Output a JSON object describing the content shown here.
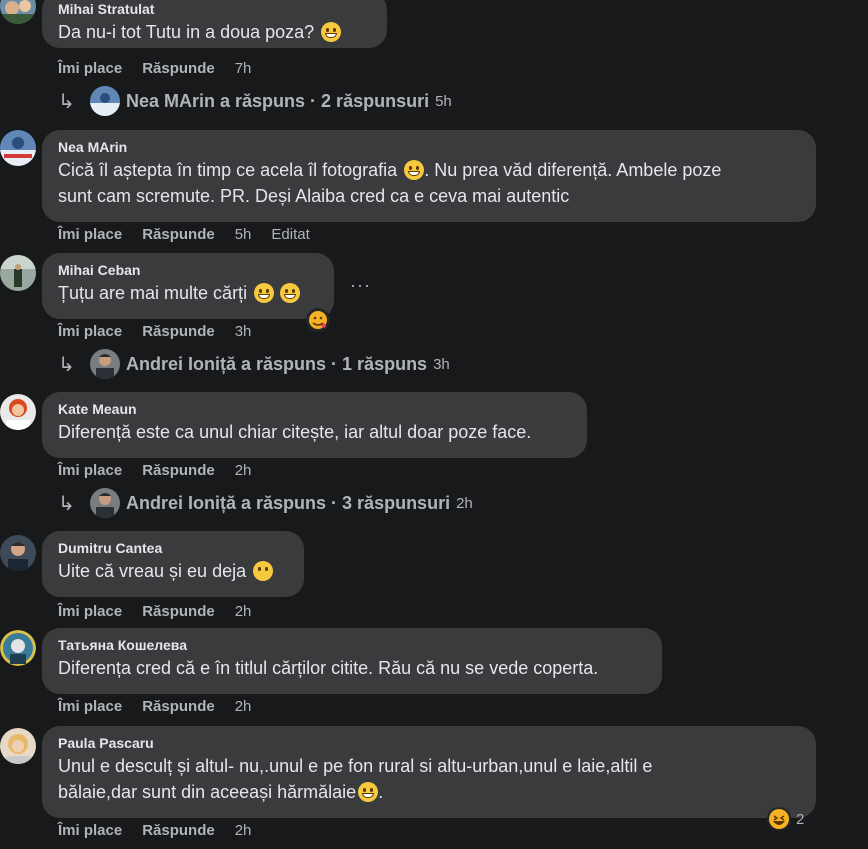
{
  "comments": [
    {
      "author": "Mihai Stratulat",
      "text": "Da nu-i tot Tutu in a doua poza?",
      "like": "Îmi place",
      "reply": "Răspunde",
      "time": "7h",
      "edited": "",
      "replies": {
        "text": "Nea MArin a răspuns · 2 răspunsuri",
        "time": "5h"
      }
    },
    {
      "author": "Nea MArin",
      "text1": "Cică îl aștepta în timp ce acela îl fotografia",
      "text1b": ". Nu prea văd diferență. Ambele poze",
      "text2": "sunt cam scremute. PR. Deși Alaiba cred ca e ceva mai autentic",
      "like": "Îmi place",
      "reply": "Răspunde",
      "time": "5h",
      "edited": "Editat"
    },
    {
      "author": "Mihai Ceban",
      "text": "Țuțu are mai multe cărți",
      "like": "Îmi place",
      "reply": "Răspunde",
      "time": "3h",
      "more": "···",
      "replies": {
        "text": "Andrei Ioniță a răspuns · 1 răspuns",
        "time": "3h"
      }
    },
    {
      "author": "Kate Meaun",
      "text": "Diferență este ca unul chiar citește, iar altul doar poze face.",
      "like": "Îmi place",
      "reply": "Răspunde",
      "time": "2h",
      "replies": {
        "text": "Andrei Ioniță a răspuns · 3 răspunsuri",
        "time": "2h"
      }
    },
    {
      "author": "Dumitru Cantea",
      "text": "Uite că vreau și eu deja",
      "like": "Îmi place",
      "reply": "Răspunde",
      "time": "2h"
    },
    {
      "author": "Татьяна Кошелева",
      "text": "Diferența cred că e în titlul cărților citite. Rău că nu se vede coperta.",
      "like": "Îmi place",
      "reply": "Răspunde",
      "time": "2h"
    },
    {
      "author": "Paula Pascaru",
      "text1": "Unul e desculț și altul- nu,.unul e pe fon rural si altu-urban,unul e laie,altil e",
      "text2": "bălaie,dar sunt din aceeași hărmălaie",
      "like": "Îmi place",
      "reply": "Răspunde",
      "time": "2h",
      "reaction_count": "2"
    }
  ],
  "icons": {
    "reply_arrow": "reply-arrow-icon",
    "emoji": "grin-emoji-icon"
  },
  "colors": {
    "background": "#18191a",
    "bubble": "#3a3b3c",
    "text": "#e4e6eb",
    "secondary": "#b0b3b8"
  }
}
